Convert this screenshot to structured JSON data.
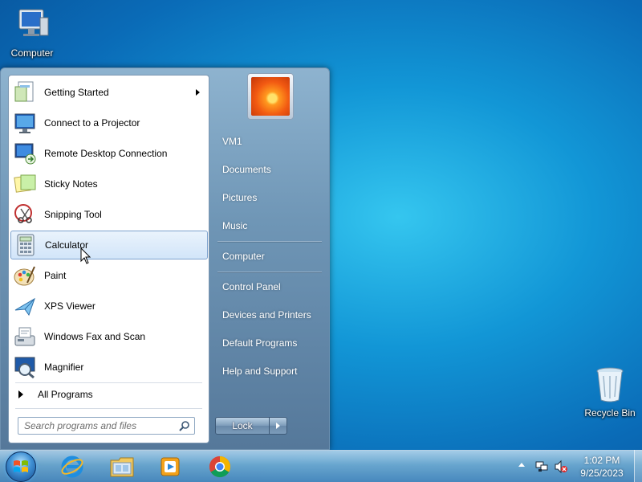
{
  "desktop": {
    "icons": [
      {
        "label": "Computer"
      },
      {
        "label": "Recycle Bin"
      }
    ]
  },
  "start_menu": {
    "programs": [
      {
        "label": "Getting Started",
        "icon": "getting-started-icon",
        "has_submenu": true
      },
      {
        "label": "Connect to a Projector",
        "icon": "projector-icon"
      },
      {
        "label": "Remote Desktop Connection",
        "icon": "remote-desktop-icon"
      },
      {
        "label": "Sticky Notes",
        "icon": "sticky-notes-icon"
      },
      {
        "label": "Snipping Tool",
        "icon": "scissors-icon"
      },
      {
        "label": "Calculator",
        "icon": "calculator-icon",
        "highlighted": true
      },
      {
        "label": "Paint",
        "icon": "paint-palette-icon"
      },
      {
        "label": "XPS Viewer",
        "icon": "xps-viewer-icon"
      },
      {
        "label": "Windows Fax and Scan",
        "icon": "fax-icon"
      },
      {
        "label": "Magnifier",
        "icon": "magnifier-icon"
      }
    ],
    "all_programs": "All Programs",
    "search": {
      "placeholder": "Search programs and files"
    },
    "right_items": [
      {
        "label": "VM1"
      },
      {
        "label": "Documents"
      },
      {
        "label": "Pictures"
      },
      {
        "label": "Music"
      },
      {
        "label": "Computer"
      },
      {
        "label": "Control Panel"
      },
      {
        "label": "Devices and Printers"
      },
      {
        "label": "Default Programs"
      },
      {
        "label": "Help and Support"
      }
    ],
    "lock_label": "Lock"
  },
  "taskbar": {
    "pinned": [
      {
        "name": "internet-explorer-icon"
      },
      {
        "name": "file-explorer-icon"
      },
      {
        "name": "media-player-icon"
      },
      {
        "name": "chrome-icon"
      }
    ],
    "time": "1:02 PM",
    "date": "9/25/2023"
  },
  "colors": {
    "highlight": "#d2e5f9",
    "taskbar": "#78afd2",
    "desktop": "#1296d6"
  }
}
